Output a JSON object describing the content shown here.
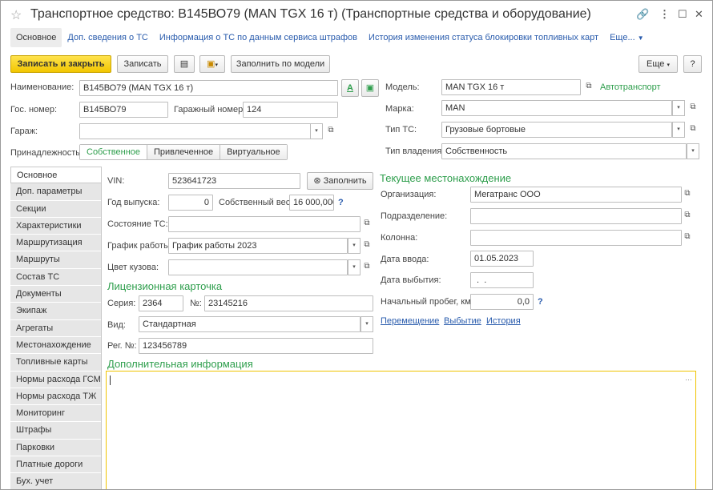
{
  "window": {
    "title": "Транспортное средство: В145ВО79 (MAN TGX 16 т) (Транспортные средства и оборудование)"
  },
  "tabs": [
    "Основное",
    "Доп. сведения о ТС",
    "Информация о ТС по данным сервиса штрафов",
    "История изменения статуса блокировки топливных карт",
    "Еще..."
  ],
  "toolbar": {
    "save_close": "Записать и закрыть",
    "save": "Записать",
    "fill_by_model": "Заполнить по модели",
    "more": "Еще",
    "help": "?"
  },
  "header": {
    "name_label": "Наименование:",
    "name_value": "В145ВО79 (MAN TGX 16 т)",
    "gos_label": "Гос. номер:",
    "gos_value": "В145ВО79",
    "garage_num_label": "Гаражный номер:",
    "garage_num_value": "124",
    "garage_label": "Гараж:",
    "garage_value": "",
    "belong_label": "Принадлежность:",
    "belong_options": [
      "Собственное",
      "Привлеченное",
      "Виртуальное"
    ],
    "model_label": "Модель:",
    "model_value": "MAN TGX 16 т",
    "model_kind": "Автотранспорт",
    "brand_label": "Марка:",
    "brand_value": "MAN",
    "type_label": "Тип ТС:",
    "type_value": "Грузовые бортовые",
    "own_label": "Тип владения:",
    "own_value": "Собственность"
  },
  "sidebar": [
    "Основное",
    "Доп. параметры",
    "Секции",
    "Характеристики",
    "Маршрутизация",
    "Маршруты",
    "Состав ТС",
    "Документы",
    "Экипаж",
    "Агрегаты",
    "Местонахождение",
    "Топливные карты",
    "Нормы расхода ГСМ",
    "Нормы расхода ТЖ",
    "Мониторинг",
    "Штрафы",
    "Парковки",
    "Платные дороги",
    "Бух. учет"
  ],
  "main": {
    "vin_label": "VIN:",
    "vin_value": "523641723",
    "fill_btn": "Заполнить",
    "year_label": "Год выпуска:",
    "year_value": "0",
    "weight_label": "Собственный вес:",
    "weight_value": "16 000,000",
    "weight_q": "?",
    "state_label": "Состояние ТС:",
    "state_value": "",
    "schedule_label": "График работы:",
    "schedule_value": "График работы 2023",
    "color_label": "Цвет кузова:",
    "color_value": "",
    "license_title": "Лицензионная карточка",
    "series_label": "Серия:",
    "series_value": "2364",
    "num_label": "№:",
    "num_value": "23145216",
    "kind_label": "Вид:",
    "kind_value": "Стандартная",
    "reg_label": "Рег. №:",
    "reg_value": "123456789",
    "extra_title": "Дополнительная информация"
  },
  "location": {
    "title": "Текущее местонахождение",
    "org_label": "Организация:",
    "org_value": "Мегатранс ООО",
    "dept_label": "Подразделение:",
    "dept_value": "",
    "column_label": "Колонна:",
    "column_value": "",
    "in_label": "Дата ввода:",
    "in_value": "01.05.2023",
    "out_label": "Дата выбытия:",
    "out_value": " .  .",
    "mileage_label": "Начальный пробег, км:",
    "mileage_value": "0,0",
    "mileage_q": "?",
    "links": [
      "Перемещение",
      "Выбытие",
      "История"
    ]
  }
}
